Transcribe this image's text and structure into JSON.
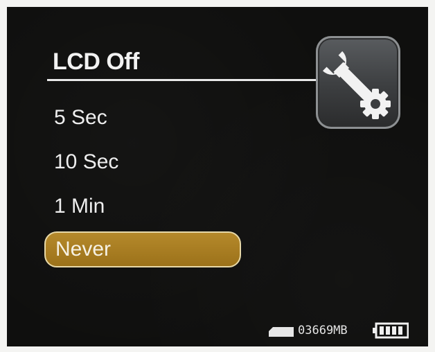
{
  "menu": {
    "title": "LCD Off",
    "options": [
      {
        "label": "5 Sec",
        "selected": false
      },
      {
        "label": "10 Sec",
        "selected": false
      },
      {
        "label": "1 Min",
        "selected": false
      },
      {
        "label": "Never",
        "selected": true
      }
    ]
  },
  "header_icon": "settings-wrench-gear-icon",
  "status_bar": {
    "storage_icon": "sd-card-icon",
    "storage_free": "03669MB",
    "battery_icon": "battery-full-icon"
  },
  "colors": {
    "background": "#0f0f0e",
    "selected_fill": "#a57a20",
    "selected_border": "#e8d9a8",
    "text": "#eeeeee"
  }
}
